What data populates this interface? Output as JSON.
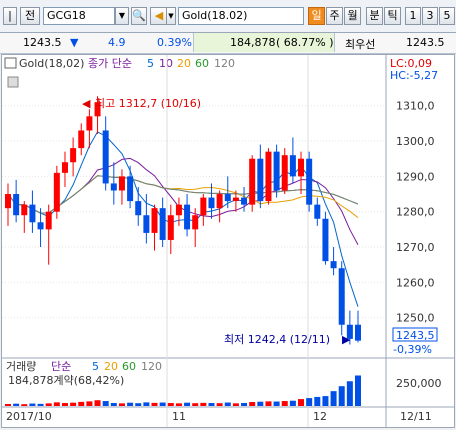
{
  "toolbar": {
    "jeon_label": "전",
    "symbol_code": "GCG18",
    "symbol_name": "Gold(18.02)",
    "period_tabs": [
      "일",
      "주",
      "월"
    ],
    "minute_label": "분",
    "tick_label": "틱",
    "interval_buttons": [
      "1",
      "3",
      "5"
    ]
  },
  "quote": {
    "price": "1243.5",
    "direction": "▼",
    "change": "4.9",
    "change_pct": "0.39%",
    "volume": "184,878",
    "volume_ratio": "( 68.77% )",
    "bid_label": "최우선",
    "bid_price": "1243.5"
  },
  "chart_header": {
    "symbol": "Gold(18,02)",
    "indicator": "종가 단순",
    "ma_periods": [
      "5",
      "10",
      "20",
      "60",
      "120"
    ],
    "lc": "LC:0,09",
    "hc": "HC:-5,27"
  },
  "annotations": {
    "high": "최고 1312,7 (10/16)",
    "low": "최저 1242,4 (12/11)",
    "current_price": "1243,5",
    "current_pct": "-0,39%"
  },
  "volume_header": {
    "label": "거래량",
    "indicator": "단순",
    "ma_periods": [
      "5",
      "20",
      "60",
      "120"
    ],
    "info": "184,878계약(68,42%)"
  },
  "colors": {
    "up": "#ff0000",
    "down": "#0050e8",
    "ma5": "#0066cc",
    "ma10": "#7a1c9e",
    "ma20": "#e8a000",
    "ma60": "#2a9a2a",
    "ma120": "#7f7f7f"
  },
  "chart_data": {
    "type": "candlestick",
    "y_ticks": [
      "1310,0",
      "1300,0",
      "1290,0",
      "1280,0",
      "1270,0",
      "1260,0",
      "1250,0"
    ],
    "y_range": [
      1240,
      1317
    ],
    "volume_tick": "250,000",
    "x_labels": [
      "2017/10",
      "11",
      "12",
      "12/11"
    ],
    "candles": [
      {
        "o": 1281,
        "h": 1288,
        "l": 1276,
        "c": 1285
      },
      {
        "o": 1285,
        "h": 1289,
        "l": 1277,
        "c": 1279
      },
      {
        "o": 1279,
        "h": 1283,
        "l": 1274,
        "c": 1282
      },
      {
        "o": 1282,
        "h": 1286,
        "l": 1274,
        "c": 1277
      },
      {
        "o": 1277,
        "h": 1281,
        "l": 1270,
        "c": 1275
      },
      {
        "o": 1275,
        "h": 1282,
        "l": 1265,
        "c": 1280
      },
      {
        "o": 1280,
        "h": 1293,
        "l": 1278,
        "c": 1291
      },
      {
        "o": 1291,
        "h": 1297,
        "l": 1287,
        "c": 1294
      },
      {
        "o": 1294,
        "h": 1301,
        "l": 1290,
        "c": 1298
      },
      {
        "o": 1298,
        "h": 1305,
        "l": 1296,
        "c": 1303
      },
      {
        "o": 1303,
        "h": 1309,
        "l": 1298,
        "c": 1307
      },
      {
        "o": 1307,
        "h": 1312.7,
        "l": 1302,
        "c": 1311
      },
      {
        "o": 1303,
        "h": 1307,
        "l": 1286,
        "c": 1288
      },
      {
        "o": 1288,
        "h": 1294,
        "l": 1282,
        "c": 1286
      },
      {
        "o": 1286,
        "h": 1292,
        "l": 1282,
        "c": 1290
      },
      {
        "o": 1290,
        "h": 1293,
        "l": 1281,
        "c": 1283
      },
      {
        "o": 1283,
        "h": 1287,
        "l": 1276,
        "c": 1279
      },
      {
        "o": 1279,
        "h": 1285,
        "l": 1271,
        "c": 1274
      },
      {
        "o": 1274,
        "h": 1282,
        "l": 1269,
        "c": 1281
      },
      {
        "o": 1281,
        "h": 1284,
        "l": 1270,
        "c": 1272
      },
      {
        "o": 1272,
        "h": 1282,
        "l": 1268,
        "c": 1279
      },
      {
        "o": 1279,
        "h": 1284,
        "l": 1276,
        "c": 1282
      },
      {
        "o": 1282,
        "h": 1285,
        "l": 1273,
        "c": 1275
      },
      {
        "o": 1275,
        "h": 1281,
        "l": 1270,
        "c": 1279
      },
      {
        "o": 1279,
        "h": 1285,
        "l": 1276,
        "c": 1284
      },
      {
        "o": 1284,
        "h": 1288,
        "l": 1278,
        "c": 1281
      },
      {
        "o": 1281,
        "h": 1286,
        "l": 1277,
        "c": 1285
      },
      {
        "o": 1285,
        "h": 1290,
        "l": 1281,
        "c": 1283
      },
      {
        "o": 1283,
        "h": 1286,
        "l": 1280,
        "c": 1284
      },
      {
        "o": 1284,
        "h": 1287,
        "l": 1280,
        "c": 1282
      },
      {
        "o": 1282,
        "h": 1296,
        "l": 1280,
        "c": 1295
      },
      {
        "o": 1295,
        "h": 1299,
        "l": 1281,
        "c": 1283
      },
      {
        "o": 1283,
        "h": 1298,
        "l": 1282,
        "c": 1297
      },
      {
        "o": 1297,
        "h": 1299,
        "l": 1284,
        "c": 1286
      },
      {
        "o": 1286,
        "h": 1298,
        "l": 1285,
        "c": 1296
      },
      {
        "o": 1296,
        "h": 1301,
        "l": 1288,
        "c": 1290
      },
      {
        "o": 1290,
        "h": 1297,
        "l": 1285,
        "c": 1295
      },
      {
        "o": 1295,
        "h": 1297,
        "l": 1280,
        "c": 1282
      },
      {
        "o": 1282,
        "h": 1284,
        "l": 1276,
        "c": 1278
      },
      {
        "o": 1278,
        "h": 1280,
        "l": 1265,
        "c": 1266
      },
      {
        "o": 1266,
        "h": 1270,
        "l": 1262,
        "c": 1264
      },
      {
        "o": 1264,
        "h": 1266,
        "l": 1245,
        "c": 1248
      },
      {
        "o": 1248,
        "h": 1252,
        "l": 1242.4,
        "c": 1244
      },
      {
        "o": 1248,
        "h": 1252,
        "l": 1243,
        "c": 1243.5
      }
    ],
    "volume": [
      12000,
      14000,
      11000,
      15000,
      13000,
      16000,
      22000,
      18000,
      20000,
      25000,
      28000,
      35000,
      30000,
      18000,
      16000,
      20000,
      17000,
      22000,
      19000,
      21000,
      18000,
      16000,
      20000,
      17000,
      19000,
      18000,
      17000,
      21000,
      16000,
      18000,
      24000,
      26000,
      28000,
      27000,
      30000,
      32000,
      42000,
      48000,
      55000,
      60000,
      90000,
      120000,
      150000,
      184878
    ]
  }
}
